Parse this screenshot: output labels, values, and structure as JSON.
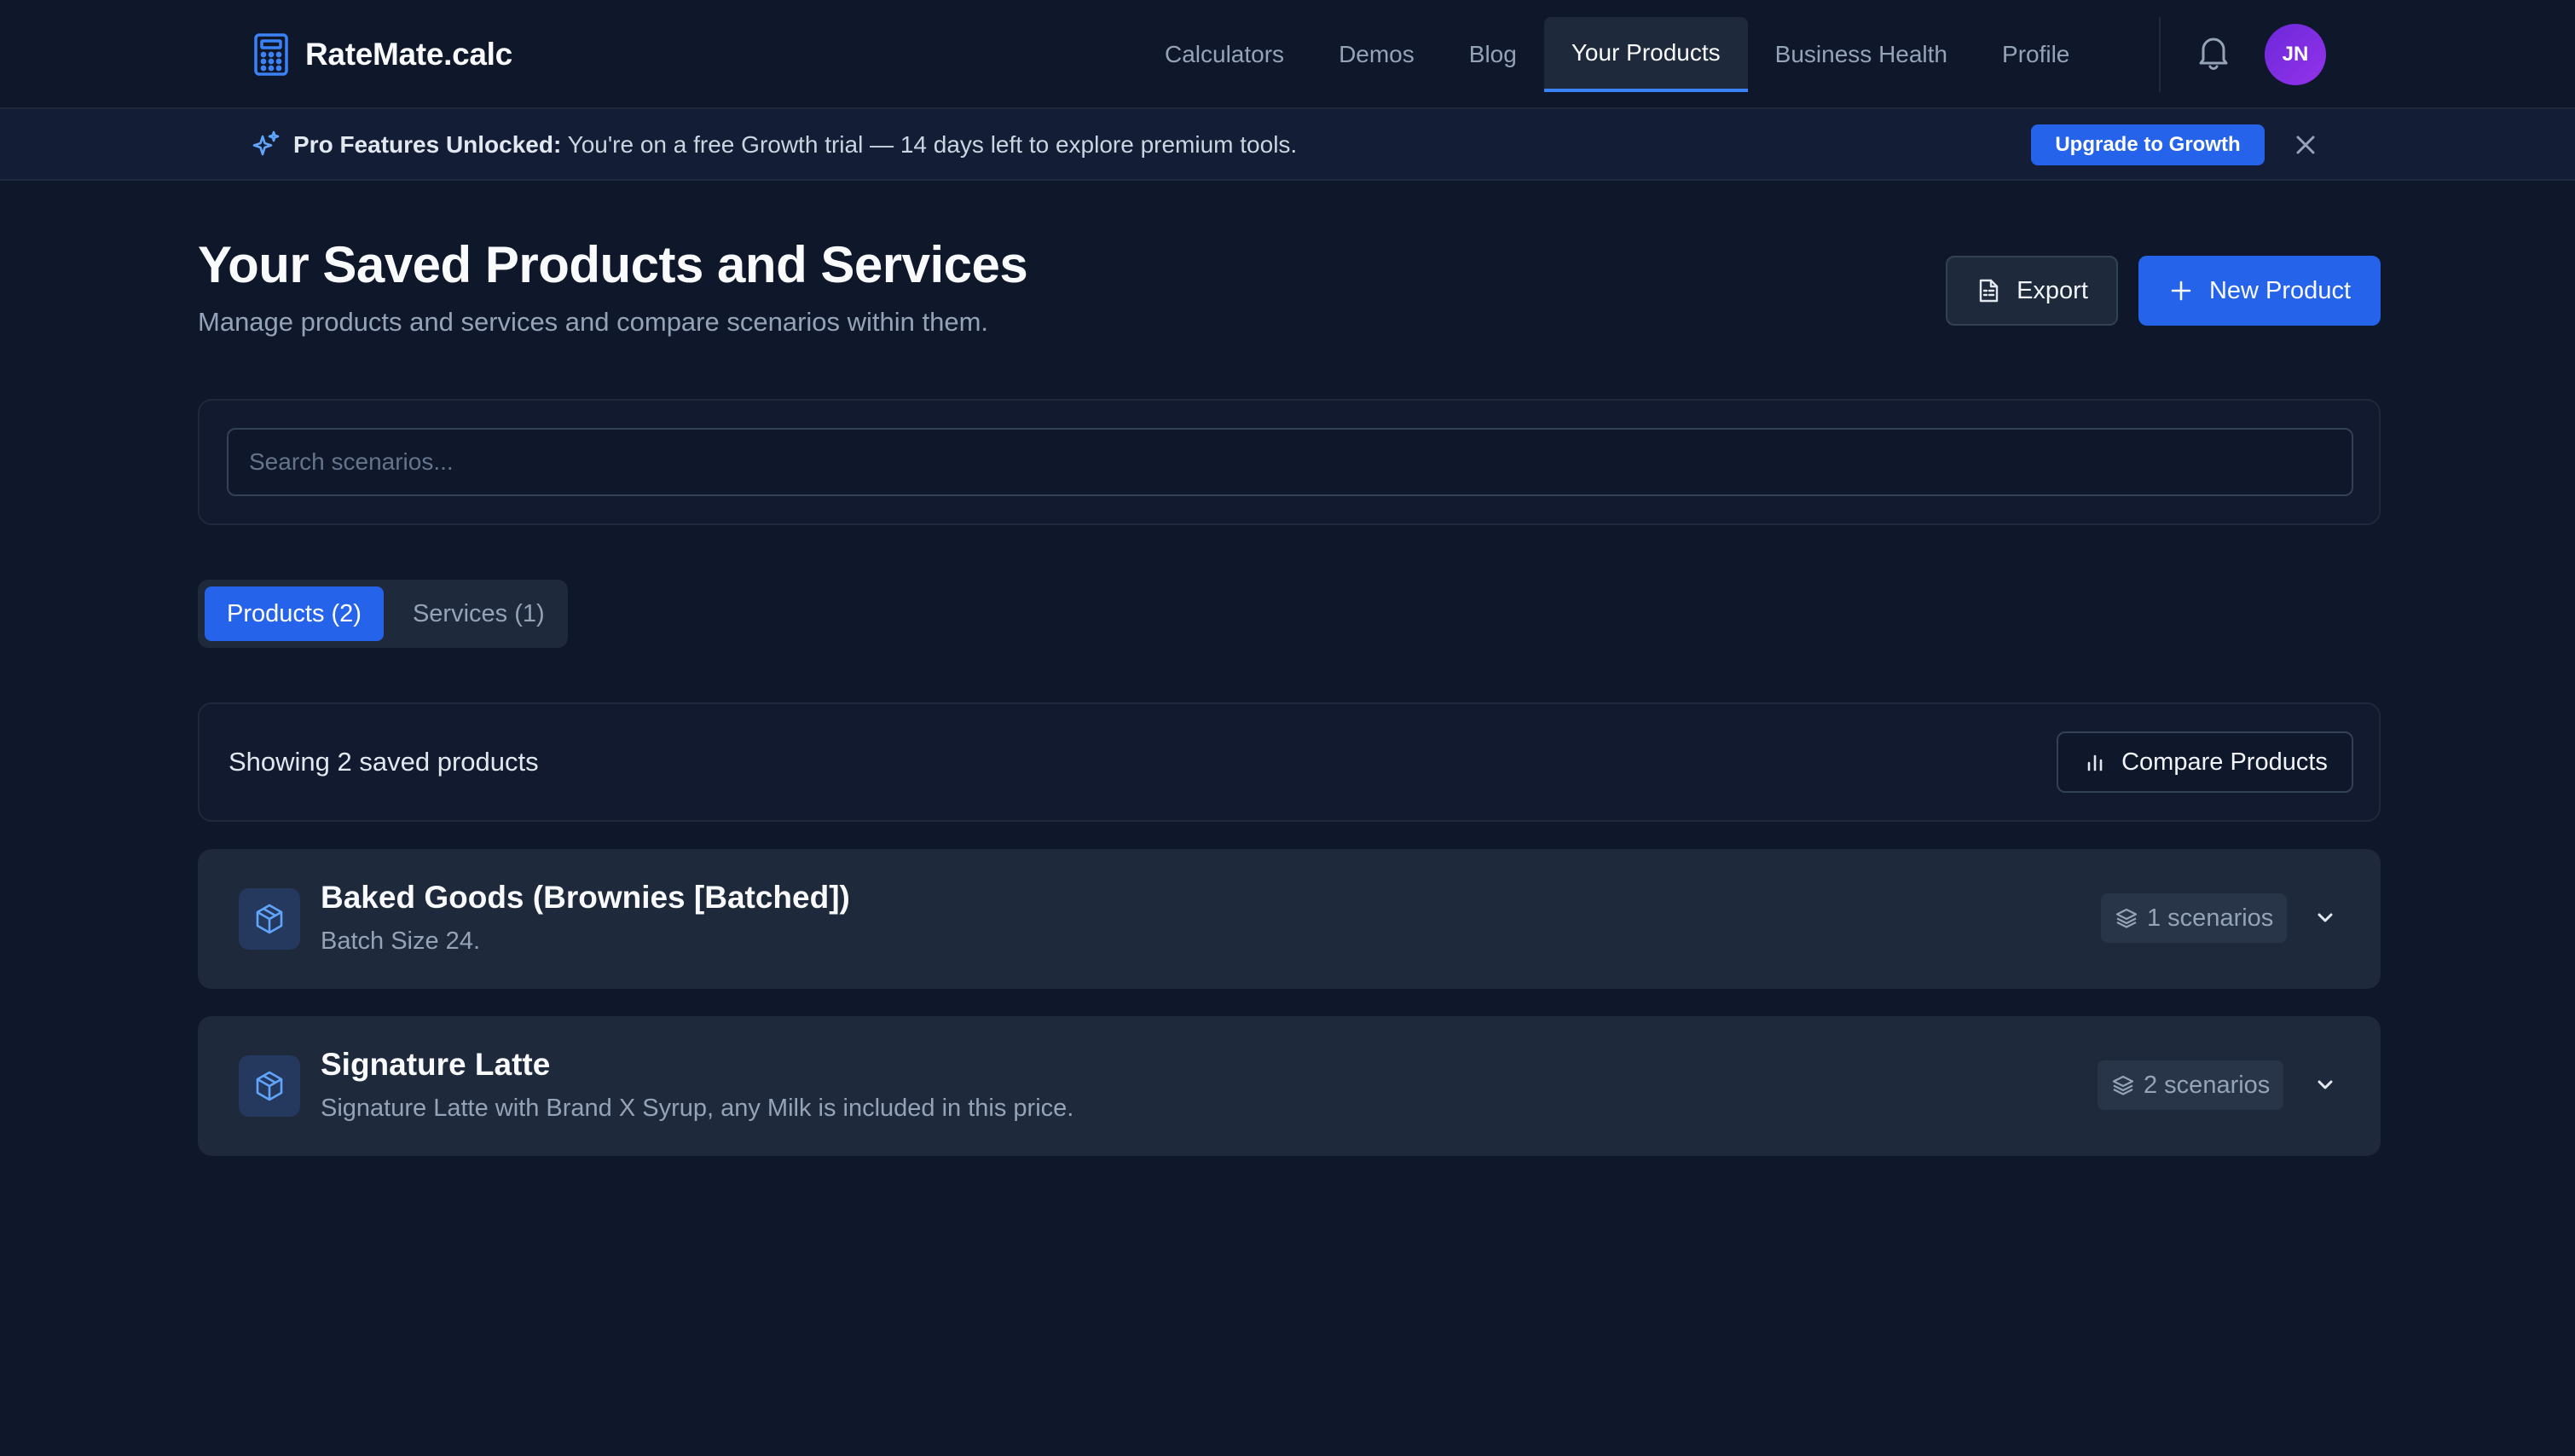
{
  "app": {
    "name": "RateMate.calc",
    "logo_icon": "calculator-icon"
  },
  "nav": {
    "links": [
      {
        "label": "Calculators",
        "active": false
      },
      {
        "label": "Demos",
        "active": false
      },
      {
        "label": "Blog",
        "active": false
      },
      {
        "label": "Your Products",
        "active": true
      },
      {
        "label": "Business Health",
        "active": false
      },
      {
        "label": "Profile",
        "active": false
      }
    ],
    "notifications_icon": "bell-icon",
    "avatar_initials": "JN"
  },
  "banner": {
    "icon": "sparkles-icon",
    "bold": "Pro Features Unlocked:",
    "text": " You're on a free Growth trial — 14 days left to explore premium tools.",
    "cta": "Upgrade to Growth",
    "close_icon": "close-icon"
  },
  "header": {
    "title": "Your Saved Products and Services",
    "subtitle": "Manage products and services and compare scenarios within them.",
    "export_label": "Export",
    "new_label": "New Product"
  },
  "search": {
    "placeholder": "Search scenarios...",
    "value": ""
  },
  "tabs": [
    {
      "label": "Products (2)",
      "active": true
    },
    {
      "label": "Services (1)",
      "active": false
    }
  ],
  "summary": {
    "text": "Showing 2 saved products",
    "compare_label": "Compare Products"
  },
  "products": [
    {
      "name": "Baked Goods (Brownies [Batched])",
      "description": "Batch Size 24.",
      "scenarios": "1 scenarios",
      "icon": "package-icon"
    },
    {
      "name": "Signature Latte",
      "description": "Signature Latte with Brand X Syrup, any Milk is included in this price.",
      "scenarios": "2 scenarios",
      "icon": "package-icon"
    }
  ],
  "colors": {
    "background": "#0f172a",
    "accent": "#2563eb",
    "card": "#1e293b",
    "avatar": "#7c3aed"
  }
}
